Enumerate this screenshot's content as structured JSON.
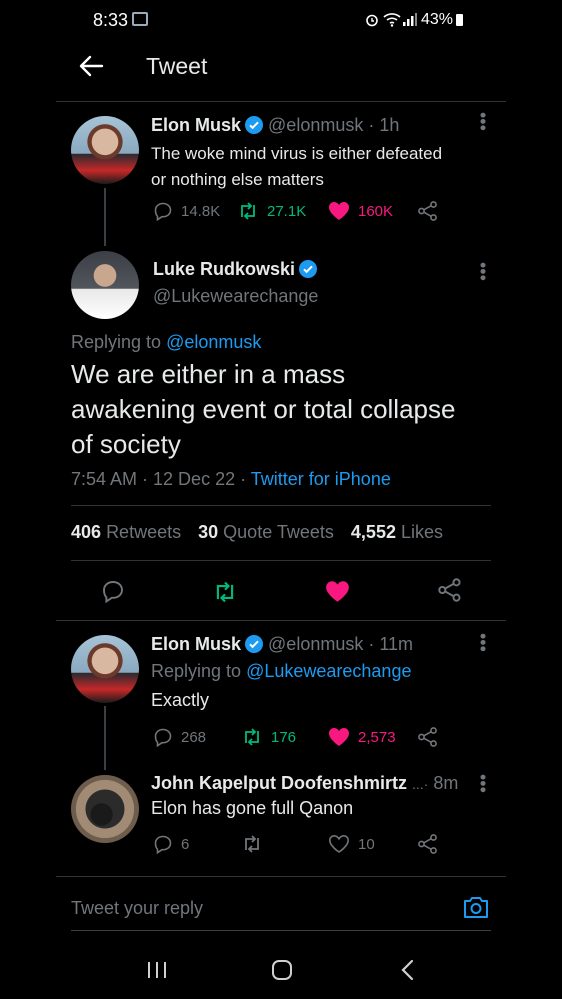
{
  "status_bar": {
    "time": "8:33",
    "battery": "43%"
  },
  "header": {
    "title": "Tweet"
  },
  "tweet1": {
    "name": "Elon Musk",
    "handle": "@elonmusk",
    "dot": "·",
    "time": "1h",
    "text1": "The woke mind virus is either defeated",
    "text2": "or nothing else matters",
    "replies": "14.8K",
    "retweets": "27.1K",
    "likes": "160K"
  },
  "main": {
    "name": "Luke Rudkowski",
    "handle": "@Lukewearechange",
    "replying_prefix": "Replying to",
    "replying_to": "@elonmusk",
    "text1": "We are either in a mass",
    "text2": "awakening event or total collapse",
    "text3": "of society",
    "timestamp": "7:54 AM · 12 Dec 22 ·",
    "source": "Twitter for iPhone",
    "retweets_count": "406",
    "retweets_label": "Retweets",
    "quotes_count": "30",
    "quotes_label": "Quote Tweets",
    "likes_count": "4,552",
    "likes_label": "Likes"
  },
  "reply1": {
    "name": "Elon Musk",
    "handle": "@elonmusk",
    "dot": "·",
    "time": "11m",
    "replying_prefix": "Replying to",
    "replying_to": "@Lukewearechange",
    "text": "Exactly",
    "replies": "268",
    "retweets": "176",
    "likes": "2,573"
  },
  "reply2": {
    "name": "John Kapelput Doofenshmirtz",
    "ellipsis": "...·",
    "time": "8m",
    "text": "Elon has gone full Qanon",
    "replies": "6",
    "likes": "10"
  },
  "composer": {
    "placeholder": "Tweet your reply"
  },
  "colors": {
    "accent": "#1d9bf0",
    "retweet": "#00ba7c",
    "like": "#f91880",
    "muted": "#71767b"
  }
}
